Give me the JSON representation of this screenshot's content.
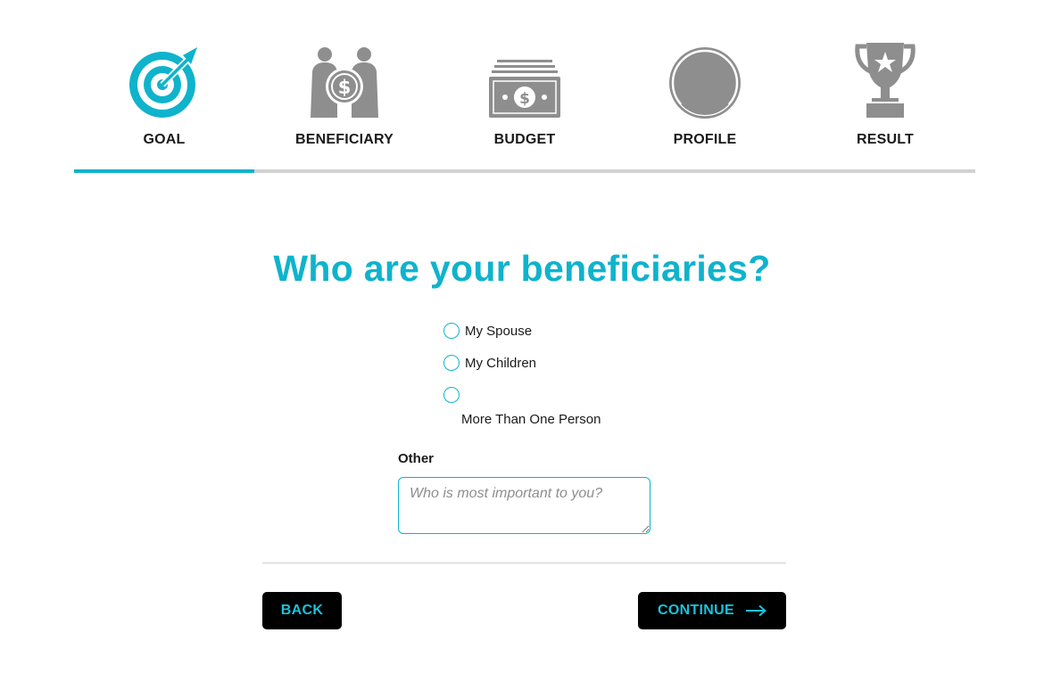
{
  "stepper": {
    "steps": [
      {
        "label": "GOAL",
        "icon": "target-icon",
        "active": true
      },
      {
        "label": "BENEFICIARY",
        "icon": "beneficiary-icon",
        "active": false
      },
      {
        "label": "BUDGET",
        "icon": "money-stack-icon",
        "active": false
      },
      {
        "label": "PROFILE",
        "icon": "user-profile-icon",
        "active": false
      },
      {
        "label": "RESULT",
        "icon": "trophy-icon",
        "active": false
      }
    ],
    "progress_fraction": 0.2
  },
  "question": {
    "title": "Who are your beneficiaries?",
    "options": [
      "My Spouse",
      "My Children",
      "More Than One Person"
    ]
  },
  "other": {
    "label": "Other",
    "placeholder": "Who is most important to you?",
    "value": ""
  },
  "buttons": {
    "back_label": "BACK",
    "continue_label": "CONTINUE"
  },
  "colors": {
    "accent": "#0fb3cc",
    "button_bg": "#000000",
    "button_text": "#18c3dc",
    "inactive_icon": "#8e8e8e"
  }
}
